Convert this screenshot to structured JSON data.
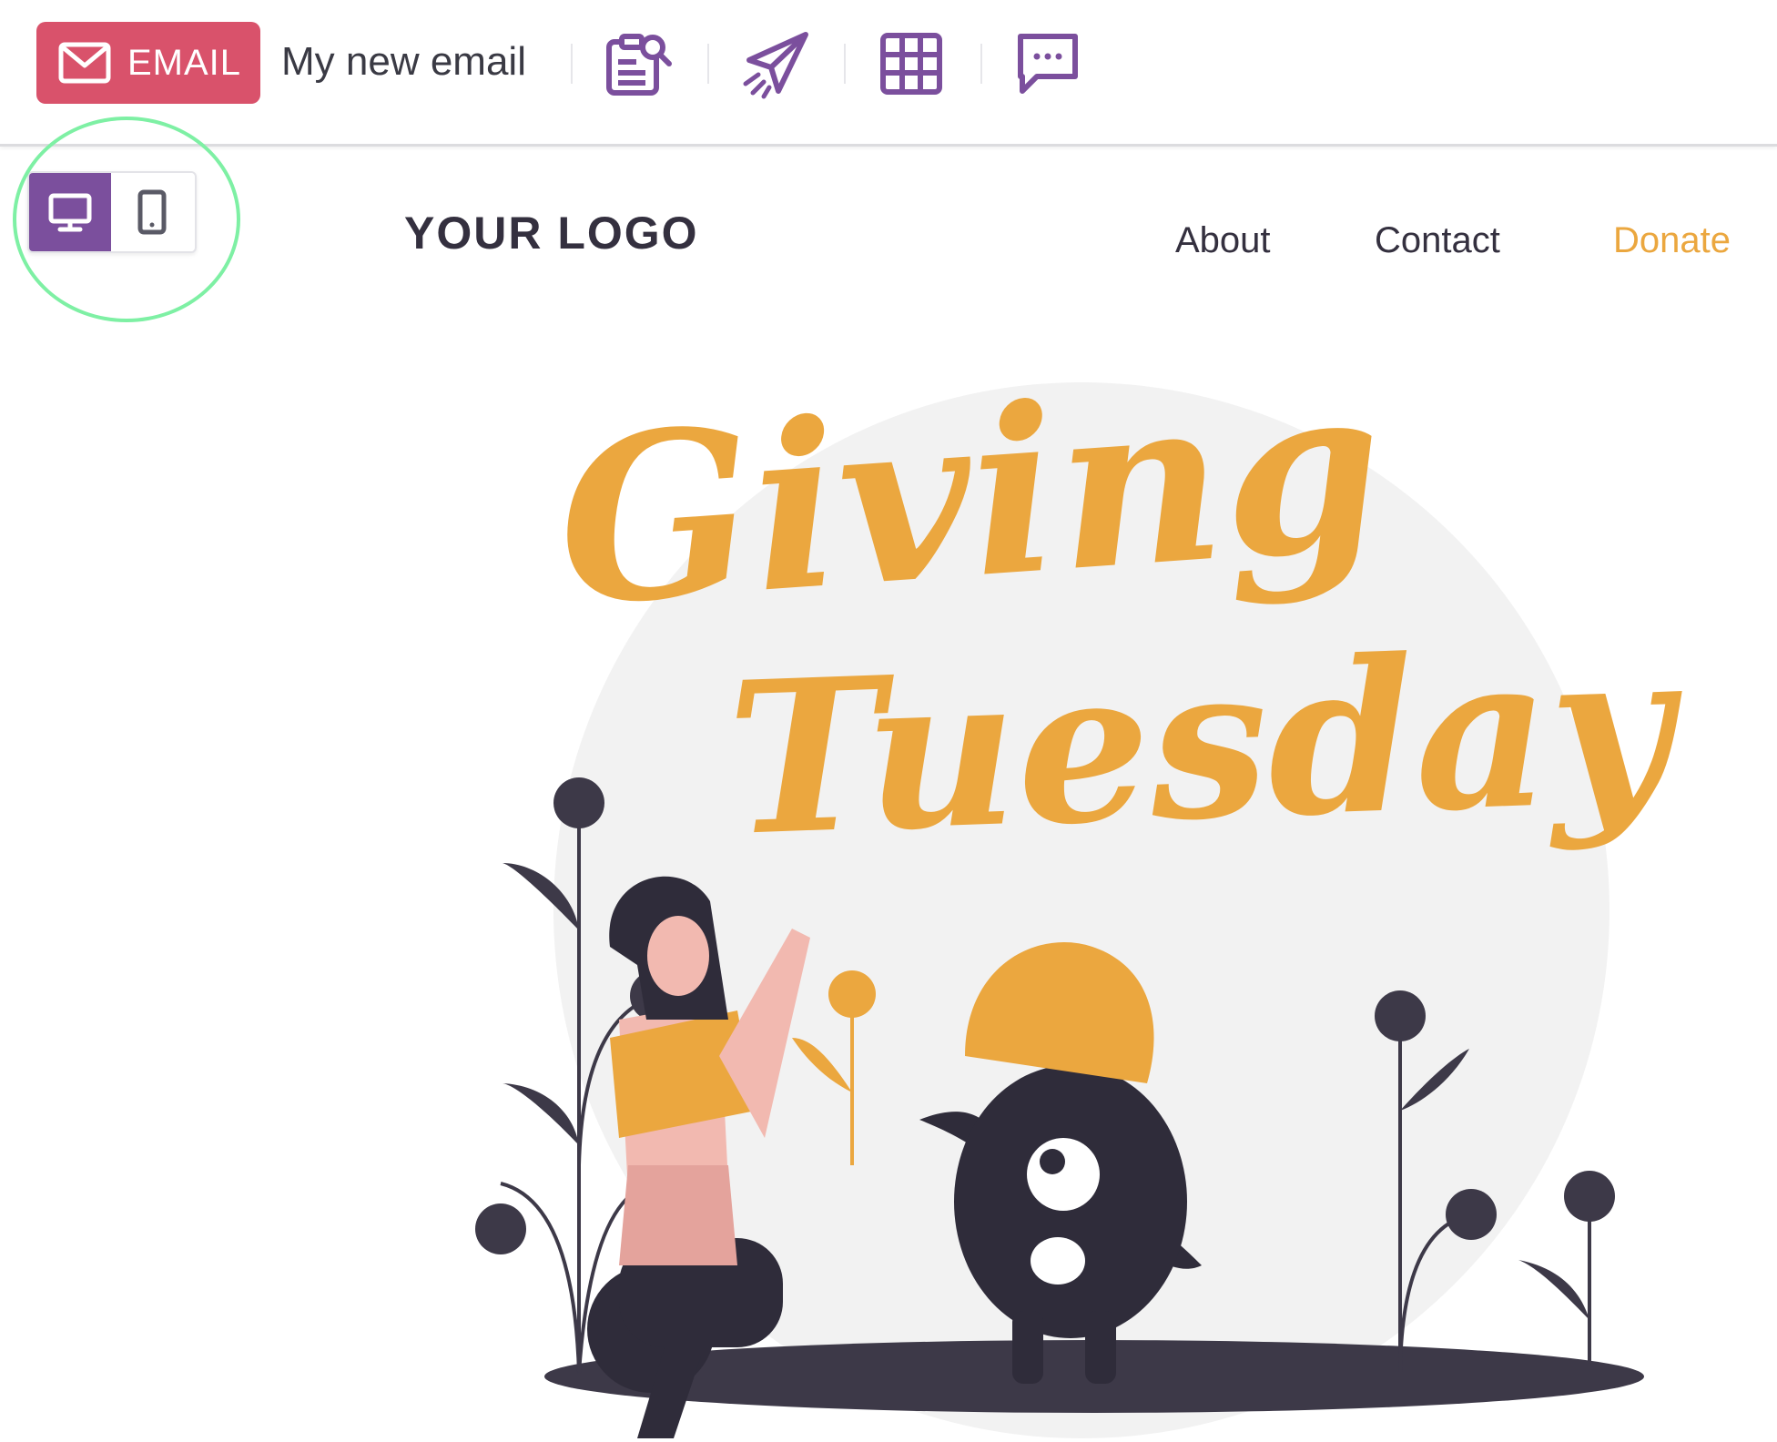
{
  "toolbar": {
    "badge_label": "EMAIL",
    "badge_icon": "envelope-icon",
    "email_name": "My new email",
    "tools": [
      {
        "icon": "preview-search-icon"
      },
      {
        "icon": "send-icon"
      },
      {
        "icon": "grid-icon"
      },
      {
        "icon": "comment-icon"
      }
    ]
  },
  "device_toggle": {
    "options": [
      {
        "icon": "desktop-icon",
        "selected": true
      },
      {
        "icon": "mobile-icon",
        "selected": false
      }
    ]
  },
  "email": {
    "logo": "YOUR LOGO",
    "nav": [
      {
        "label": "About"
      },
      {
        "label": "Contact"
      },
      {
        "label": "Donate"
      }
    ],
    "hero": {
      "line1": "Giving",
      "line2": "Tuesday"
    }
  },
  "colors": {
    "badge": "#d9526b",
    "accent_purple": "#7b4f9d",
    "orange": "#eba73f",
    "dark": "#34303f",
    "highlight": "#7ef0a4"
  }
}
